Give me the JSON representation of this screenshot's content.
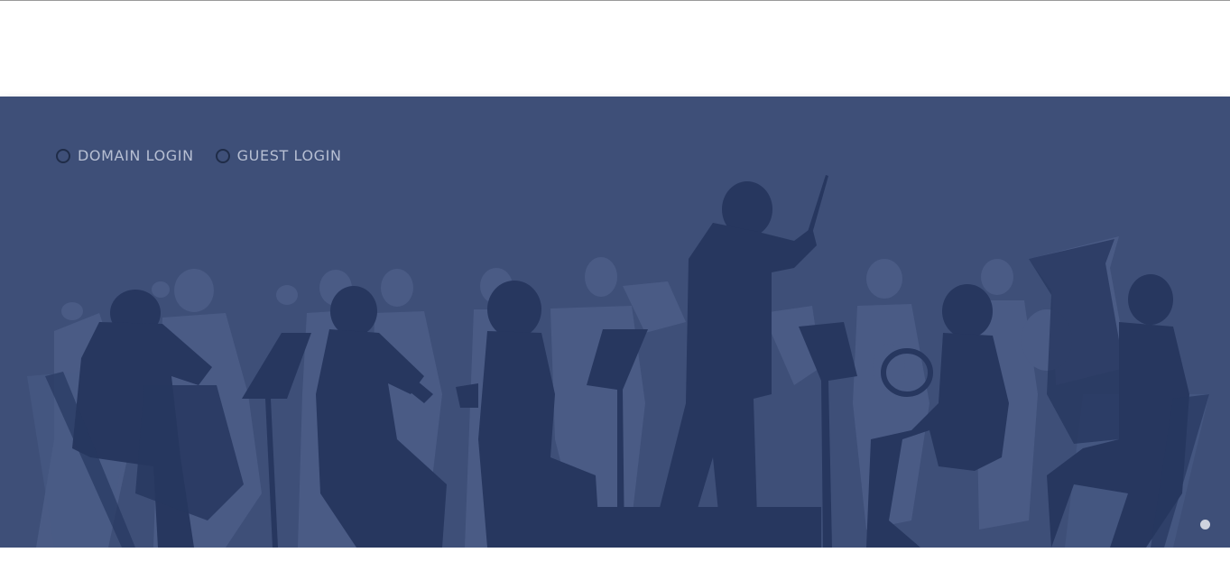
{
  "login": {
    "options": [
      {
        "label": "DOMAIN LOGIN",
        "selected": false
      },
      {
        "label": "GUEST LOGIN",
        "selected": false
      }
    ]
  },
  "banner": {
    "illustration": "orchestra-silhouette",
    "background_color": "#3e4f78",
    "silhouette_back_color": "#4a5b85",
    "silhouette_front_color": "#27375f"
  },
  "carousel": {
    "indicator_color": "#cfd3de"
  }
}
